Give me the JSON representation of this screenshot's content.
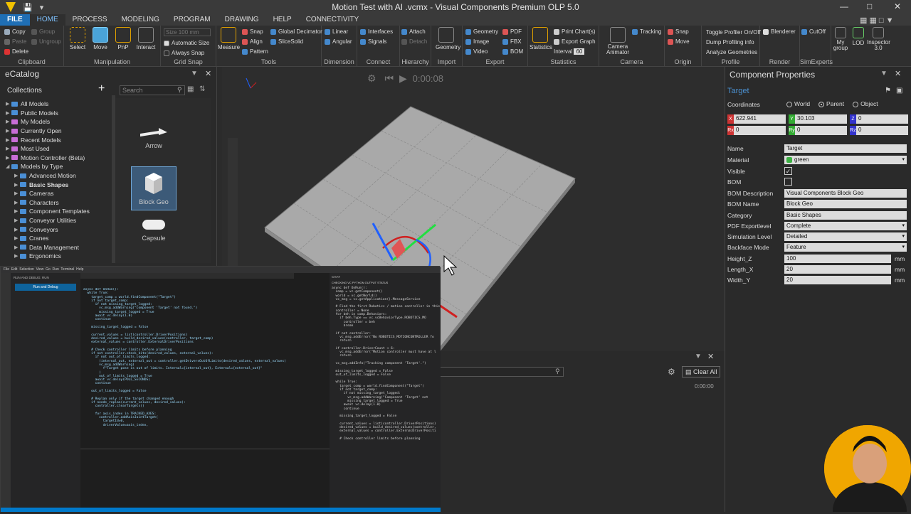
{
  "window": {
    "title": "Motion Test with AI .vcmx - Visual Components Premium OLP 5.0"
  },
  "tabs": [
    "FILE",
    "HOME",
    "PROCESS",
    "MODELING",
    "PROGRAM",
    "DRAWING",
    "HELP",
    "CONNECTIVITY"
  ],
  "ribbon": {
    "clipboard": {
      "title": "Clipboard",
      "items": [
        "Copy",
        "Paste",
        "Delete",
        "Group",
        "Ungroup"
      ]
    },
    "manipulation": {
      "title": "Manipulation",
      "select": "Select",
      "move": "Move",
      "pnp": "PnP",
      "interact": "Interact"
    },
    "grid_snap": {
      "title": "Grid Snap",
      "size": "100 mm",
      "auto_size": "Automatic Size",
      "always_snap": "Always Snap"
    },
    "tools": {
      "title": "Tools",
      "measure": "Measure",
      "snap": "Snap",
      "align": "Align",
      "pattern": "Pattern",
      "global_decimator": "Global Decimator",
      "slicesolid": "SliceSolid"
    },
    "dimension": {
      "title": "Dimension",
      "linear": "Linear",
      "angular": "Angular"
    },
    "connect": {
      "title": "Connect",
      "interfaces": "Interfaces",
      "signals": "Signals"
    },
    "hierarchy": {
      "title": "Hierarchy",
      "attach": "Attach",
      "detach": "Detach"
    },
    "import": {
      "title": "Import",
      "geometry": "Geometry"
    },
    "export": {
      "title": "Export",
      "geometry": "Geometry",
      "image": "Image",
      "video": "Video",
      "pdf": "PDF",
      "fbx": "FBX",
      "bom": "BOM"
    },
    "statistics": {
      "title": "Statistics",
      "statistics": "Statistics",
      "print_charts": "Print Chart(s)",
      "export_graph": "Export Graph",
      "interval_label": "Interval",
      "interval_value": "60"
    },
    "camera": {
      "title": "Camera",
      "camera_animator": "Camera Animator",
      "tracking": "Tracking"
    },
    "origin": {
      "title": "Origin",
      "snap": "Snap",
      "move": "Move"
    },
    "profile": {
      "title": "Profile",
      "toggle": "Toggle Profiler On/Off",
      "dump": "Dump Profiling info",
      "analyze": "Analyze Geometries"
    },
    "render": {
      "title": "Render",
      "blenderer": "Blenderer"
    },
    "simexperts": {
      "title": "SimExperts",
      "cutoff": "CutOff"
    },
    "misc": {
      "my_group": "My group",
      "lod": "LOD",
      "inspector": "Inspector 3.0"
    }
  },
  "ecatalog": {
    "title": "eCatalog",
    "collections_label": "Collections",
    "search_placeholder": "Search",
    "tree": [
      {
        "label": "All Models",
        "bold": false,
        "indent": 1,
        "color": "#4a8fd6"
      },
      {
        "label": "Public Models",
        "bold": false,
        "indent": 1,
        "color": "#4a8fd6"
      },
      {
        "label": "My Models",
        "bold": false,
        "indent": 1,
        "color": "#c86dd7"
      },
      {
        "label": "Currently Open",
        "bold": false,
        "indent": 1,
        "color": "#c86dd7"
      },
      {
        "label": "Recent Models",
        "bold": false,
        "indent": 1,
        "color": "#c86dd7"
      },
      {
        "label": "Most Used",
        "bold": false,
        "indent": 1,
        "color": "#c86dd7"
      },
      {
        "label": "Motion Controller (Beta)",
        "bold": false,
        "indent": 1,
        "color": "#c86dd7"
      },
      {
        "label": "Models by Type",
        "bold": false,
        "indent": 1,
        "color": "#4a8fd6"
      },
      {
        "label": "Advanced Motion",
        "bold": false,
        "indent": 2,
        "color": "#4a8fd6"
      },
      {
        "label": "Basic Shapes",
        "bold": true,
        "indent": 2,
        "color": "#4a8fd6"
      },
      {
        "label": "Cameras",
        "bold": false,
        "indent": 2,
        "color": "#4a8fd6"
      },
      {
        "label": "Characters",
        "bold": false,
        "indent": 2,
        "color": "#4a8fd6"
      },
      {
        "label": "Component Templates",
        "bold": false,
        "indent": 2,
        "color": "#4a8fd6"
      },
      {
        "label": "Conveyor Utilities",
        "bold": false,
        "indent": 2,
        "color": "#4a8fd6"
      },
      {
        "label": "Conveyors",
        "bold": false,
        "indent": 2,
        "color": "#4a8fd6"
      },
      {
        "label": "Cranes",
        "bold": false,
        "indent": 2,
        "color": "#4a8fd6"
      },
      {
        "label": "Data Management",
        "bold": false,
        "indent": 2,
        "color": "#4a8fd6"
      },
      {
        "label": "Ergonomics",
        "bold": false,
        "indent": 2,
        "color": "#4a8fd6"
      }
    ],
    "gallery": [
      "Arrow",
      "Block Geo",
      "Capsule"
    ]
  },
  "viewport": {
    "time": "0:00:08"
  },
  "properties": {
    "title": "Component Properties",
    "object_name": "Target",
    "coordinates_label": "Coordinates",
    "coord_modes": [
      "World",
      "Parent",
      "Object"
    ],
    "coord_selected": "Parent",
    "x": "622.941",
    "y": "30.103",
    "z": "0",
    "rx": "0",
    "ry": "0",
    "rz": "0",
    "rows": [
      {
        "label": "Name",
        "value": "Target"
      },
      {
        "label": "Material",
        "value": "green"
      },
      {
        "label": "Visible",
        "value": ""
      },
      {
        "label": "BOM",
        "value": ""
      },
      {
        "label": "BOM Description",
        "value": "Visual Components Block Geo"
      },
      {
        "label": "BOM Name",
        "value": "Block Geo"
      },
      {
        "label": "Category",
        "value": "Basic Shapes"
      },
      {
        "label": "PDF Exportlevel",
        "value": "Complete"
      },
      {
        "label": "Simulation Level",
        "value": "Detailed"
      },
      {
        "label": "Backface Mode",
        "value": "Feature"
      },
      {
        "label": "Height_Z",
        "value": "100",
        "unit": "mm"
      },
      {
        "label": "Length_X",
        "value": "20",
        "unit": "mm"
      },
      {
        "label": "Width_Y",
        "value": "20",
        "unit": "mm"
      }
    ],
    "visible_checked": true,
    "bom_checked": false
  },
  "output": {
    "clear_all": "Clear All",
    "time": "0:00:00"
  },
  "vscode": {
    "run_debug": "RUN AND DEBUG: RUN",
    "run_button": "Run and Debug",
    "chat_title": "CHAT",
    "chat_heading": "CHECKING VC PYTHON OUTPUT STATUS",
    "code_left": "async def OnRun():\n  while True:\n    target_comp = world.findComponent(\"Target\")\n    if not target_comp:\n      if not missing_target_logged:\n        vc_msg.addWarning(\"Component 'Target' not found.\")\n        missing_target_logged = True\n      await vc.delay(1.0)\n      continue\n\n    missing_target_logged = False\n\n    current_values = list(controller.DriverPositions)\n    desired_values = build_desired_values(controller, target_comp)\n    external_values = controller.ExternalDriverPositions\n\n    # Check controller limits before planning\n    if not controller.check_kits(desired_values, external_values):\n      if not out_of_limits_logged:\n        (internal_out, external_out = controller.getDriversOutOfLimits(desired_values, external_values)\n        vc_msg.addWarning(\n          f\"Target pose is out of limits. Internal={internal_out}, External={external_out}\"\n        )\n        out_of_limits_logged = True\n      await vc.delay(POLL_SECONDS)\n      continue\n\n    out_of_limits_logged = False\n\n    # Replan only if the target changed enough\n    if needs_replan(current_values, desired_values):\n      controller.clearTargets()\n\n      for axis_index in TRACKED_AXES:\n        controller.addAxisJointTarget(\n          targetId=0,\n          driverValue=axis_index,",
    "code_right": "async def OnRun():\n  comp = vc.getComponent()\n  world = vc.getWorld()\n  vc_msg = vc.getApplication().MessageService\n\n  # Find the first Robotics / motion controller in this\n  controller = None\n  for beh in comp.Behaviors:\n    if beh.Type == vc.vcBehaviorType.ROBOTICS_MO\n      controller = beh\n      break\n\n  if not controller:\n    vc_msg.addError(\"No ROBOTICS_MOTIONCONTROLLER fo\n    return\n\n  if controller.DriverCount < 6:\n    vc_msg.addError(\"Motion controller must have at l\n    return\n\n  vc_msg.addInfo(\"Tracking component 'Target'.\")\n\n  missing_target_logged = False\n  out_of_limits_logged = False\n\n  while True:\n    target_comp = world.findComponent(\"Target\")\n    if not target_comp:\n      if not missing_target_logged:\n        vc_msg.addWarning(\"Component 'Target' not\n        missing_target_logged = True\n      await vc.delay(1.0)\n      continue\n\n    missing_target_logged = False\n\n    current_values = list(controller.DriverPositions)\n    desired_values = build_desired_values(controller,\n    external_values = controller.ExternalDriverPositi\n\n    # Check controller limits before planning"
  }
}
